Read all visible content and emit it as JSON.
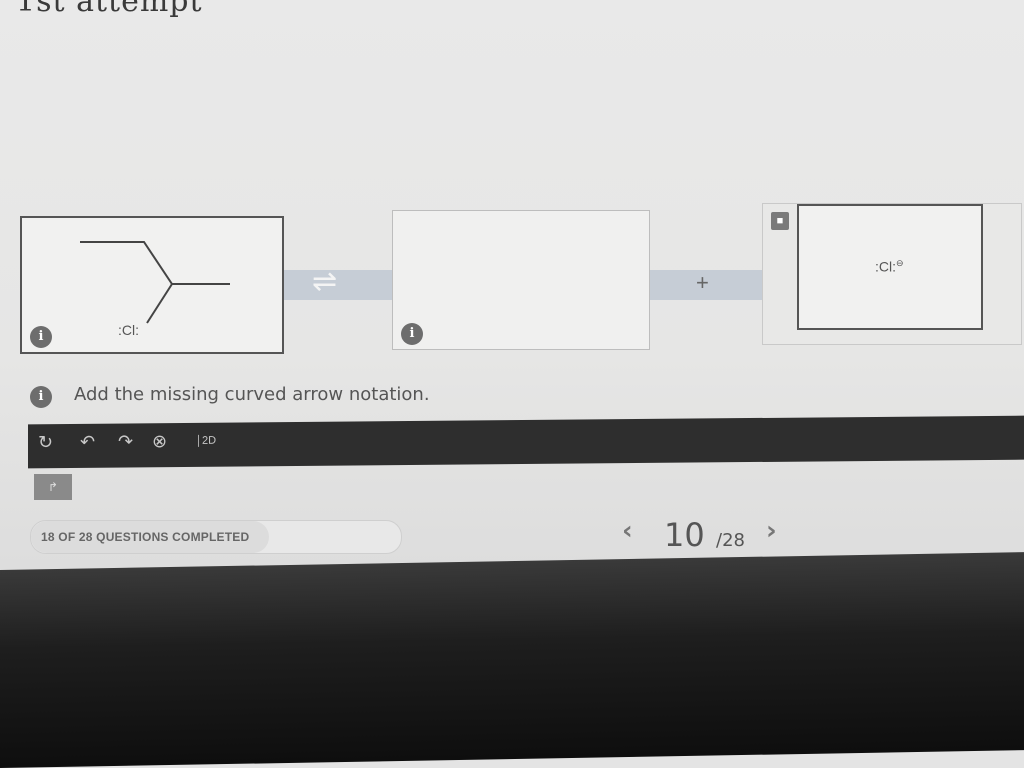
{
  "heading": {
    "attempt": "1st attempt"
  },
  "reaction": {
    "reactant_atom": ":Cl:",
    "equilibrium_symbol": "⇌",
    "plus": "+",
    "product": {
      "locked": true,
      "atom": ":Cl:",
      "charge": "⊖"
    },
    "info_badge": "i"
  },
  "instruction": {
    "text": "Add the missing curved arrow notation."
  },
  "toolbar": {
    "tools": [
      {
        "name": "reset-icon",
        "glyph": "↻"
      },
      {
        "name": "undo-icon",
        "glyph": "↶"
      },
      {
        "name": "redo-icon",
        "glyph": "↷"
      },
      {
        "name": "zoom-icon",
        "glyph": "⊗"
      },
      {
        "name": "2d-view-icon",
        "glyph": "2D"
      }
    ],
    "arrow_tool": "↱"
  },
  "progress": {
    "label": "18 OF 28 QUESTIONS COMPLETED",
    "completed": 18,
    "total": 28
  },
  "pager": {
    "prev": "‹",
    "current": "10",
    "total": "/28",
    "next": "›"
  }
}
